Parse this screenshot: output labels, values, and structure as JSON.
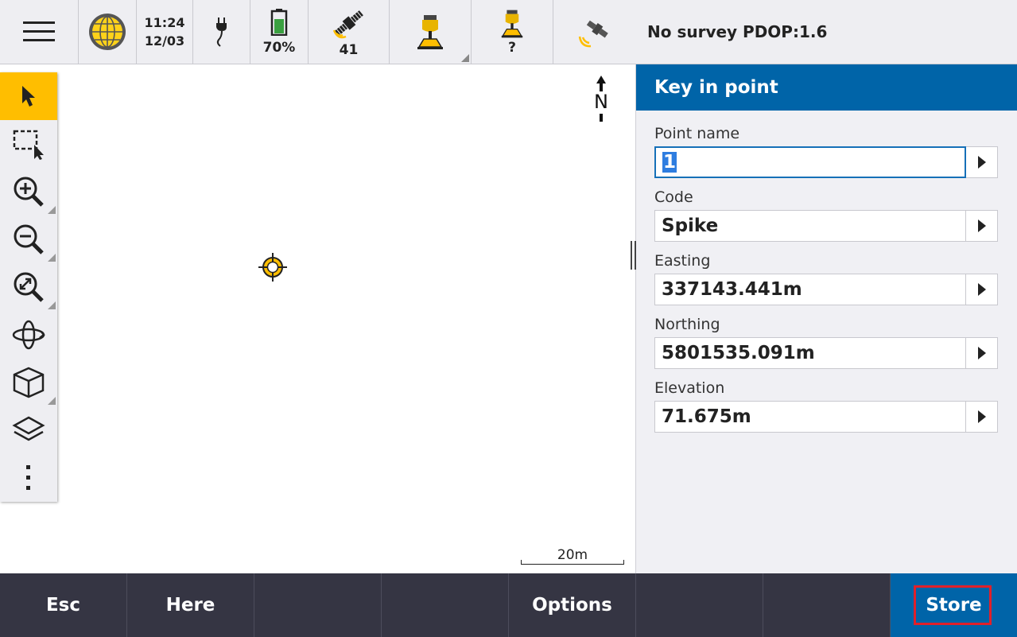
{
  "statusbar": {
    "menu_icon": "hamburger-menu-icon",
    "globe_icon": "globe-icon",
    "time": "11:24",
    "date": "12/03",
    "power_icon": "power-plug-icon",
    "battery_percent": "70%",
    "battery_level": 0.7,
    "satellites_count": "41",
    "receiver_status": "",
    "instrument_status": "?"
  },
  "titlebar": {
    "text": "No survey  PDOP:1.6"
  },
  "toolbar": {
    "items": [
      {
        "name": "select-tool",
        "icon": "pointer-arrow-icon",
        "active": true
      },
      {
        "name": "box-select-tool",
        "icon": "box-select-icon"
      },
      {
        "name": "zoom-in-tool",
        "icon": "zoom-in-icon"
      },
      {
        "name": "zoom-out-tool",
        "icon": "zoom-out-icon"
      },
      {
        "name": "zoom-extents-tool",
        "icon": "zoom-extents-icon"
      },
      {
        "name": "orbit-tool",
        "icon": "orbit-icon"
      },
      {
        "name": "view-cube-tool",
        "icon": "cube-icon"
      },
      {
        "name": "layers-tool",
        "icon": "layers-icon"
      },
      {
        "name": "more-tool",
        "icon": "more-vertical-icon"
      }
    ]
  },
  "map": {
    "north_label": "N",
    "scale_label": "20m"
  },
  "panel": {
    "title": "Key in point",
    "fields": [
      {
        "label": "Point name",
        "value": "1"
      },
      {
        "label": "Code",
        "value": "Spike"
      },
      {
        "label": "Easting",
        "value": "337143.441m"
      },
      {
        "label": "Northing",
        "value": "5801535.091m"
      },
      {
        "label": "Elevation",
        "value": "71.675m"
      }
    ]
  },
  "softkeys": {
    "esc": "Esc",
    "here": "Here",
    "blank1": "",
    "options": "Options",
    "blank2": "",
    "blank3": "",
    "store": "Store"
  },
  "colors": {
    "accent_blue": "#0064a8",
    "active_tool": "#ffbe00",
    "softkey_bg": "#353543",
    "store_outline": "#e0202a"
  }
}
